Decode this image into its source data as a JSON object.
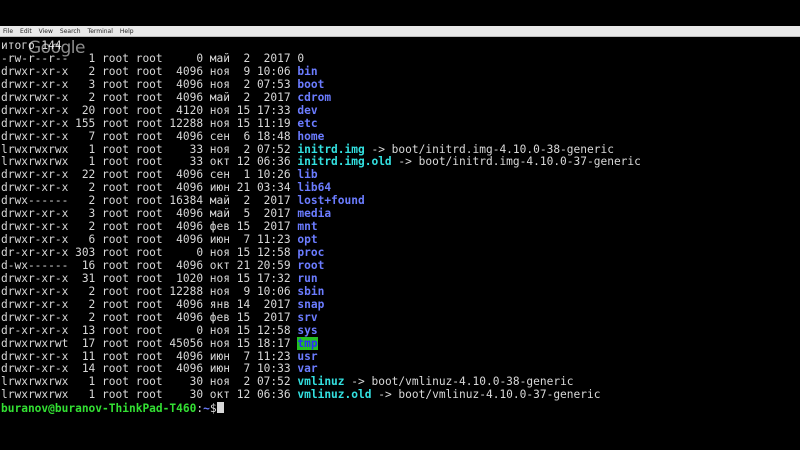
{
  "menu": [
    "File",
    "Edit",
    "View",
    "Search",
    "Terminal",
    "Help"
  ],
  "watermark": "Google",
  "first_line": "итого 144",
  "listing": [
    {
      "perms": "-rw-r--r--",
      "links": "1",
      "owner": "root",
      "group": "root",
      "size": "0",
      "month": "май",
      "day": "2",
      "time": "2017",
      "name": "0",
      "kind": "plain"
    },
    {
      "perms": "drwxr-xr-x",
      "links": "2",
      "owner": "root",
      "group": "root",
      "size": "4096",
      "month": "ноя",
      "day": "9",
      "time": "10:06",
      "name": "bin",
      "kind": "dir"
    },
    {
      "perms": "drwxr-xr-x",
      "links": "3",
      "owner": "root",
      "group": "root",
      "size": "4096",
      "month": "ноя",
      "day": "2",
      "time": "07:53",
      "name": "boot",
      "kind": "dir"
    },
    {
      "perms": "drwxrwxr-x",
      "links": "2",
      "owner": "root",
      "group": "root",
      "size": "4096",
      "month": "май",
      "day": "2",
      "time": "2017",
      "name": "cdrom",
      "kind": "dir"
    },
    {
      "perms": "drwxr-xr-x",
      "links": "20",
      "owner": "root",
      "group": "root",
      "size": "4120",
      "month": "ноя",
      "day": "15",
      "time": "17:33",
      "name": "dev",
      "kind": "dir"
    },
    {
      "perms": "drwxr-xr-x",
      "links": "155",
      "owner": "root",
      "group": "root",
      "size": "12288",
      "month": "ноя",
      "day": "15",
      "time": "11:19",
      "name": "etc",
      "kind": "dir"
    },
    {
      "perms": "drwxr-xr-x",
      "links": "7",
      "owner": "root",
      "group": "root",
      "size": "4096",
      "month": "сен",
      "day": "6",
      "time": "18:48",
      "name": "home",
      "kind": "dir"
    },
    {
      "perms": "lrwxrwxrwx",
      "links": "1",
      "owner": "root",
      "group": "root",
      "size": "33",
      "month": "ноя",
      "day": "2",
      "time": "07:52",
      "name": "initrd.img",
      "kind": "link",
      "target": " -> boot/initrd.img-4.10.0-38-generic"
    },
    {
      "perms": "lrwxrwxrwx",
      "links": "1",
      "owner": "root",
      "group": "root",
      "size": "33",
      "month": "окт",
      "day": "12",
      "time": "06:36",
      "name": "initrd.img.old",
      "kind": "link",
      "target": " -> boot/initrd.img-4.10.0-37-generic"
    },
    {
      "perms": "drwxr-xr-x",
      "links": "22",
      "owner": "root",
      "group": "root",
      "size": "4096",
      "month": "сен",
      "day": "1",
      "time": "10:26",
      "name": "lib",
      "kind": "dir"
    },
    {
      "perms": "drwxr-xr-x",
      "links": "2",
      "owner": "root",
      "group": "root",
      "size": "4096",
      "month": "июн",
      "day": "21",
      "time": "03:34",
      "name": "lib64",
      "kind": "dir"
    },
    {
      "perms": "drwx------",
      "links": "2",
      "owner": "root",
      "group": "root",
      "size": "16384",
      "month": "май",
      "day": "2",
      "time": "2017",
      "name": "lost+found",
      "kind": "dir"
    },
    {
      "perms": "drwxr-xr-x",
      "links": "3",
      "owner": "root",
      "group": "root",
      "size": "4096",
      "month": "май",
      "day": "5",
      "time": "2017",
      "name": "media",
      "kind": "dir"
    },
    {
      "perms": "drwxr-xr-x",
      "links": "2",
      "owner": "root",
      "group": "root",
      "size": "4096",
      "month": "фев",
      "day": "15",
      "time": "2017",
      "name": "mnt",
      "kind": "dir"
    },
    {
      "perms": "drwxr-xr-x",
      "links": "6",
      "owner": "root",
      "group": "root",
      "size": "4096",
      "month": "июн",
      "day": "7",
      "time": "11:23",
      "name": "opt",
      "kind": "dir"
    },
    {
      "perms": "dr-xr-xr-x",
      "links": "303",
      "owner": "root",
      "group": "root",
      "size": "0",
      "month": "ноя",
      "day": "15",
      "time": "12:58",
      "name": "proc",
      "kind": "dir"
    },
    {
      "perms": "d-wx------",
      "links": "16",
      "owner": "root",
      "group": "root",
      "size": "4096",
      "month": "окт",
      "day": "21",
      "time": "20:59",
      "name": "root",
      "kind": "dir"
    },
    {
      "perms": "drwxr-xr-x",
      "links": "31",
      "owner": "root",
      "group": "root",
      "size": "1020",
      "month": "ноя",
      "day": "15",
      "time": "17:32",
      "name": "run",
      "kind": "dir"
    },
    {
      "perms": "drwxr-xr-x",
      "links": "2",
      "owner": "root",
      "group": "root",
      "size": "12288",
      "month": "ноя",
      "day": "9",
      "time": "10:06",
      "name": "sbin",
      "kind": "dir"
    },
    {
      "perms": "drwxr-xr-x",
      "links": "2",
      "owner": "root",
      "group": "root",
      "size": "4096",
      "month": "янв",
      "day": "14",
      "time": "2017",
      "name": "snap",
      "kind": "dir"
    },
    {
      "perms": "drwxr-xr-x",
      "links": "2",
      "owner": "root",
      "group": "root",
      "size": "4096",
      "month": "фев",
      "day": "15",
      "time": "2017",
      "name": "srv",
      "kind": "dir"
    },
    {
      "perms": "dr-xr-xr-x",
      "links": "13",
      "owner": "root",
      "group": "root",
      "size": "0",
      "month": "ноя",
      "day": "15",
      "time": "12:58",
      "name": "sys",
      "kind": "dir"
    },
    {
      "perms": "drwxrwxrwt",
      "links": "17",
      "owner": "root",
      "group": "root",
      "size": "45056",
      "month": "ноя",
      "day": "15",
      "time": "18:17",
      "name": "tmp",
      "kind": "tmp"
    },
    {
      "perms": "drwxr-xr-x",
      "links": "11",
      "owner": "root",
      "group": "root",
      "size": "4096",
      "month": "июн",
      "day": "7",
      "time": "11:23",
      "name": "usr",
      "kind": "dir"
    },
    {
      "perms": "drwxr-xr-x",
      "links": "14",
      "owner": "root",
      "group": "root",
      "size": "4096",
      "month": "июн",
      "day": "7",
      "time": "10:33",
      "name": "var",
      "kind": "dir"
    },
    {
      "perms": "lrwxrwxrwx",
      "links": "1",
      "owner": "root",
      "group": "root",
      "size": "30",
      "month": "ноя",
      "day": "2",
      "time": "07:52",
      "name": "vmlinuz",
      "kind": "link",
      "target": " -> boot/vmlinuz-4.10.0-38-generic"
    },
    {
      "perms": "lrwxrwxrwx",
      "links": "1",
      "owner": "root",
      "group": "root",
      "size": "30",
      "month": "окт",
      "day": "12",
      "time": "06:36",
      "name": "vmlinuz.old",
      "kind": "link",
      "target": " -> boot/vmlinuz-4.10.0-37-generic"
    }
  ],
  "prompt": {
    "user_host": "buranov@buranov-ThinkPad-T460",
    "separator": ":",
    "path": "~",
    "symbol": "$"
  },
  "colors": {
    "dir": "#6b7cff",
    "link": "#33e0e0",
    "tmp_fg": "#2b2bff",
    "tmp_bg": "#22c022",
    "prompt_user": "#33e033"
  }
}
